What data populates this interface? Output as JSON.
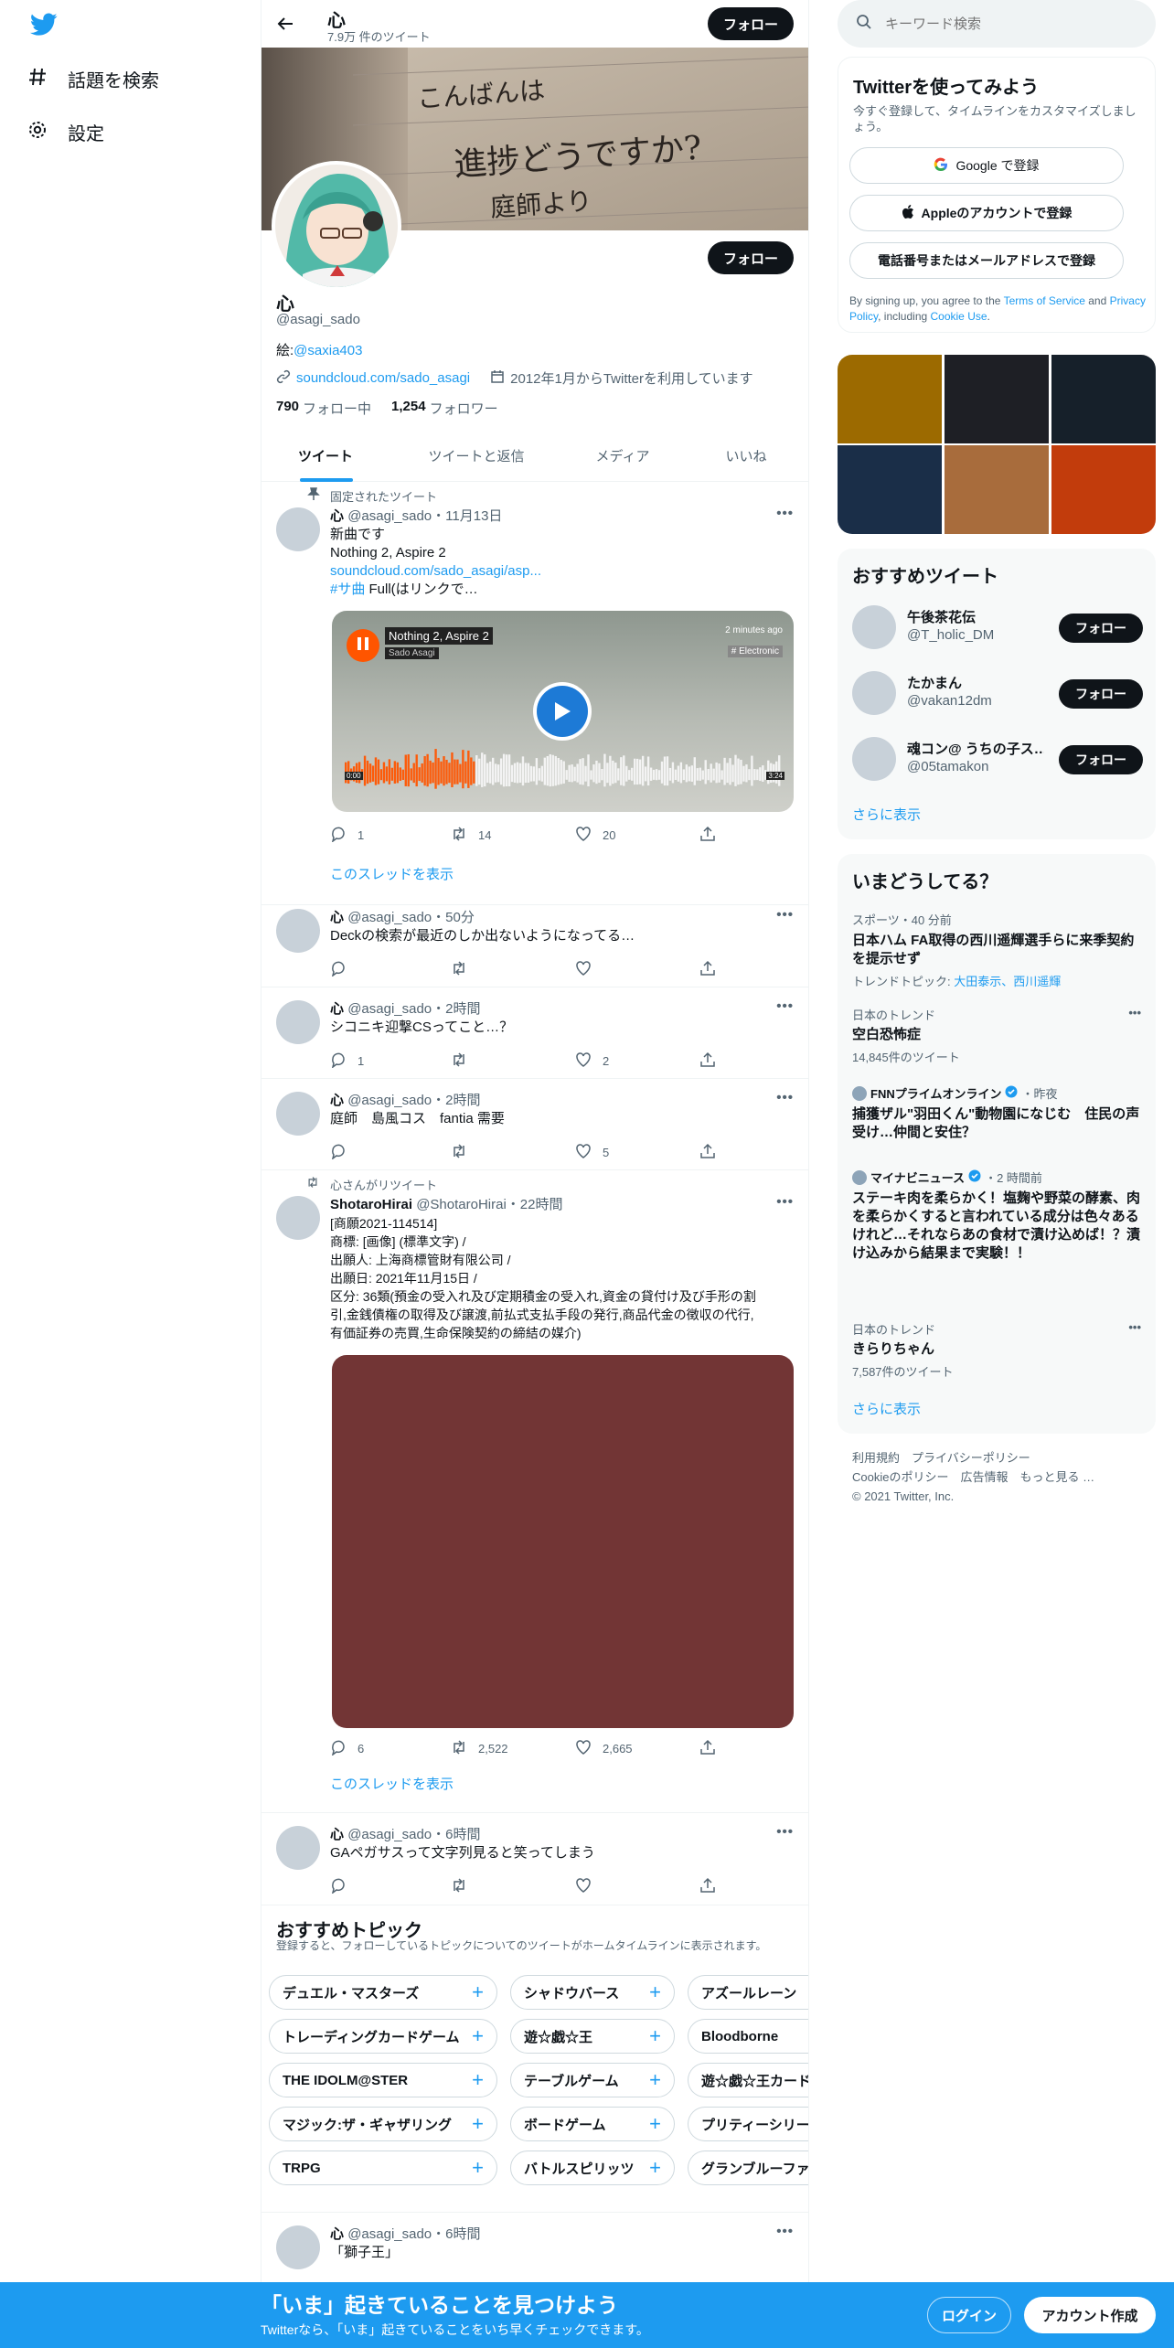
{
  "nav": {
    "explore": "話題を検索",
    "settings": "設定"
  },
  "profile": {
    "name": "心",
    "tweet_count": "7.9万 件のツイート",
    "follow_label": "フォロー",
    "handle": "@asagi_sado",
    "bio_prefix": "絵:",
    "bio_link": "@saxia403",
    "website": "soundcloud.com/sado_asagi",
    "joined": "2012年1月からTwitterを利用しています",
    "following_count": "790",
    "following_label": "フォロー中",
    "followers_count": "1,254",
    "followers_label": "フォロワー",
    "banner_text": [
      "こんばんは",
      "進捗どうですか?",
      "庭師より"
    ]
  },
  "tabs": [
    "ツイート",
    "ツイートと返信",
    "メディア",
    "いいね"
  ],
  "tweets": [
    {
      "context": "固定されたツイート",
      "name": "心",
      "handle": "@asagi_sado",
      "time": "・11月13日",
      "lines": [
        "新曲です",
        "Nothing 2, Aspire 2"
      ],
      "link": "soundcloud.com/sado_asagi/asp...",
      "hashtag": "#サ曲",
      "after_hashtag": " Full(はリンクで…",
      "card": {
        "title": "Nothing 2, Aspire 2",
        "artist": "Sado Asagi",
        "ago": "2 minutes ago",
        "genre": "# Electronic",
        "t_start": "0:00",
        "t_end": "3:24",
        "progress": 0.3
      },
      "reply": "1",
      "retweet": "14",
      "like": "20",
      "thread": "このスレッドを表示"
    },
    {
      "name": "心",
      "handle": "@asagi_sado",
      "time": "・50分",
      "text": "Deckの検索が最近のしか出ないようになってる…",
      "reply": "",
      "retweet": "",
      "like": ""
    },
    {
      "name": "心",
      "handle": "@asagi_sado",
      "time": "・2時間",
      "text": "シコニキ迎撃CSってこと…？",
      "reply": "1",
      "retweet": "",
      "like": "2"
    },
    {
      "name": "心",
      "handle": "@asagi_sado",
      "time": "・2時間",
      "text": "庭師　島風コス　fantia 需要",
      "reply": "",
      "retweet": "",
      "like": "5"
    },
    {
      "context": "心さんがリツイート",
      "name": "ShotaroHirai",
      "handle": "@ShotaroHirai",
      "time": "・22時間",
      "lines": [
        "[商願2021-114514]",
        "商標: [画像] (標準文字) /",
        "出願人: 上海商標管財有限公司 /",
        "出願日: 2021年11月15日 /",
        "区分: 36類(預金の受入れ及び定期積金の受入れ,資金の貸付け及び手形の割",
        "引,金銭債権の取得及び譲渡,前払式支払手段の発行,商品代金の徴収の代行,",
        "有価証券の売買,生命保険契約の締結の媒介)"
      ],
      "reply": "6",
      "retweet": "2,522",
      "like": "2,665",
      "thread": "このスレッドを表示"
    },
    {
      "name": "心",
      "handle": "@asagi_sado",
      "time": "・6時間",
      "text": "GAペガサスって文字列見ると笑ってしまう",
      "reply": "",
      "retweet": "",
      "like": ""
    },
    {
      "name": "心",
      "handle": "@asagi_sado",
      "time": "・6時間",
      "text": "「獅子王」"
    }
  ],
  "topics": {
    "title": "おすすめトピック",
    "desc": "登録すると、フォローしているトピックについてのツイートがホームタイムラインに表示されます。",
    "rows": [
      [
        "デュエル・マスターズ",
        "シャドウバース",
        "アズールレーン"
      ],
      [
        "トレーディングカードゲーム",
        "遊☆戯☆王",
        "Bloodborne"
      ],
      [
        "THE IDOLM@STER",
        "テーブルゲーム",
        "遊☆戯☆王カード"
      ],
      [
        "マジック:ザ・ギャザリング",
        "ボードゲーム",
        "プリティーシリー"
      ],
      [
        "TRPG",
        "バトルスピリッツ",
        "グランブルーファ"
      ]
    ]
  },
  "right": {
    "search_placeholder": "キーワード検索",
    "signup": {
      "title": "Twitterを使ってみよう",
      "desc": "今すぐ登録して、タイムラインをカスタマイズしましょう。",
      "google": "Google で登録",
      "apple": "Appleのアカウントで登録",
      "phone": "電話番号またはメールアドレスで登録",
      "terms_1": "By signing up, you agree to the ",
      "terms_link": "Terms of Service",
      "terms_2": " and ",
      "privacy": "Privacy Policy",
      "terms_3": ", including ",
      "cookie": "Cookie Use",
      "terms_4": "."
    },
    "gallery_colors": [
      "#9c6a00",
      "#1e1f25",
      "#16202a",
      "#1a2e48",
      "#a86c3c",
      "#c23c0c"
    ],
    "wtf": {
      "title": "おすすめツイート",
      "users": [
        {
          "name": "午後茶花伝",
          "handle": "@T_holic_DM"
        },
        {
          "name": "たかまん",
          "handle": "@vakan12dm"
        },
        {
          "name": "魂コン@ うちの子ス…",
          "handle": "@05tamakon"
        }
      ],
      "follow": "フォロー",
      "more": "さらに表示"
    },
    "trends": {
      "title": "いまどうしてる？",
      "items": [
        {
          "cat": "スポーツ・40 分前",
          "name": "日本ハム FA取得の西川遥輝選手らに来季契約を提示せず",
          "sub_prefix": "トレンドトピック: ",
          "sub_links": "大田泰示、西川遥輝"
        },
        {
          "cat": "日本のトレンド",
          "name": "空白恐怖症",
          "sub": "14,845件のツイート"
        },
        {
          "source": "FNNプライムオンライン",
          "cat": "・昨夜",
          "name": "捕獲ザル\"羽田くん\"動物園になじむ　住民の声受け…仲間と安住？"
        },
        {
          "source": "マイナビニュース",
          "cat": "・2 時間前",
          "name": "ステーキ肉を柔らかく！塩麹や野菜の酵素、肉を柔らかくすると言われている成分は色々あるけれど…それならあの食材で漬け込めば！？漬け込みから結果まで実験！！"
        },
        {
          "cat": "日本のトレンド",
          "name": "きらりちゃん",
          "sub": "7,587件のツイート"
        }
      ],
      "more": "さらに表示"
    },
    "footer": {
      "line1": "利用規約　プライバシーポリシー",
      "line2": "Cookieのポリシー　広告情報　もっと見る …",
      "line3": "© 2021 Twitter, Inc."
    }
  },
  "bottom": {
    "title": "「いま」起きていることを見つけよう",
    "sub": "Twitterなら、「いま」起きていることをいち早くチェックできます。",
    "login": "ログイン",
    "signup": "アカウント作成"
  },
  "colors": {
    "accent": "#1d9bf0",
    "soundcloud": "#ff5500",
    "media_placeholder": "#723535"
  }
}
